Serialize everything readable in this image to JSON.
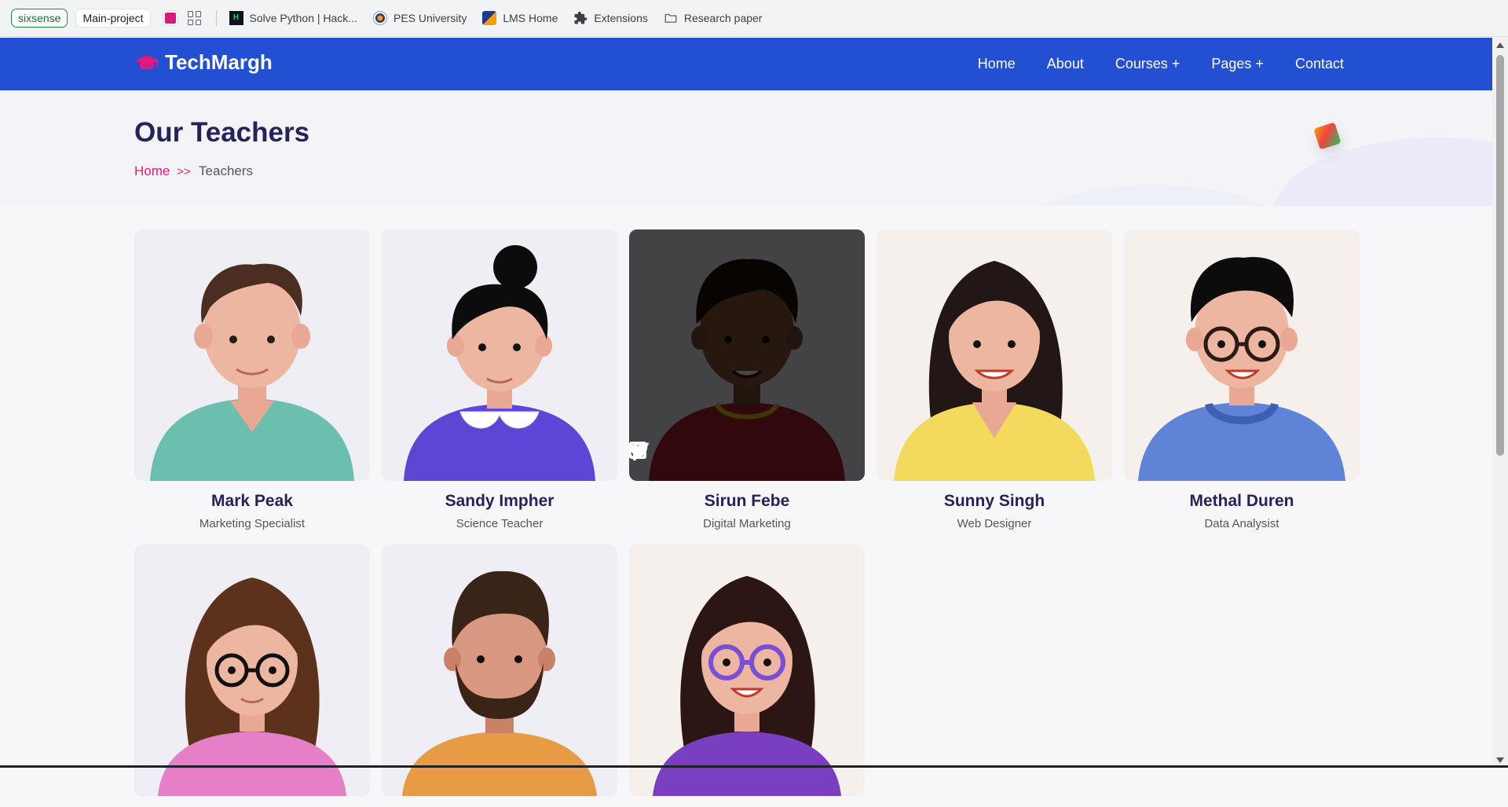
{
  "bookmarks": {
    "chip_green": "sixsense",
    "chip_grey": "Main-project",
    "items": [
      {
        "label": "Solve Python | Hack...",
        "icon": "hackerrank-icon"
      },
      {
        "label": "PES University",
        "icon": "pes-icon"
      },
      {
        "label": "LMS Home",
        "icon": "lms-icon"
      },
      {
        "label": "Extensions",
        "icon": "puzzle-icon"
      },
      {
        "label": "Research paper",
        "icon": "folder-icon"
      }
    ]
  },
  "site": {
    "brand": "TechMargh",
    "accent": "#234fd3",
    "pink": "#e6197a",
    "nav": [
      "Home",
      "About",
      "Courses +",
      "Pages +",
      "Contact"
    ]
  },
  "hero": {
    "title": "Our Teachers",
    "breadcrumb": {
      "home": "Home",
      "sep": ">>",
      "current": "Teachers"
    }
  },
  "teachers": [
    {
      "name": "Mark Peak",
      "role": "Marketing Specialist"
    },
    {
      "name": "Sandy Impher",
      "role": "Science Teacher"
    },
    {
      "name": "Sirun Febe",
      "role": "Digital Marketing"
    },
    {
      "name": "Sunny Singh",
      "role": "Web Designer"
    },
    {
      "name": "Methal Duren",
      "role": "Data Analysist"
    },
    {
      "name": "",
      "role": ""
    },
    {
      "name": "",
      "role": ""
    },
    {
      "name": "",
      "role": ""
    }
  ]
}
